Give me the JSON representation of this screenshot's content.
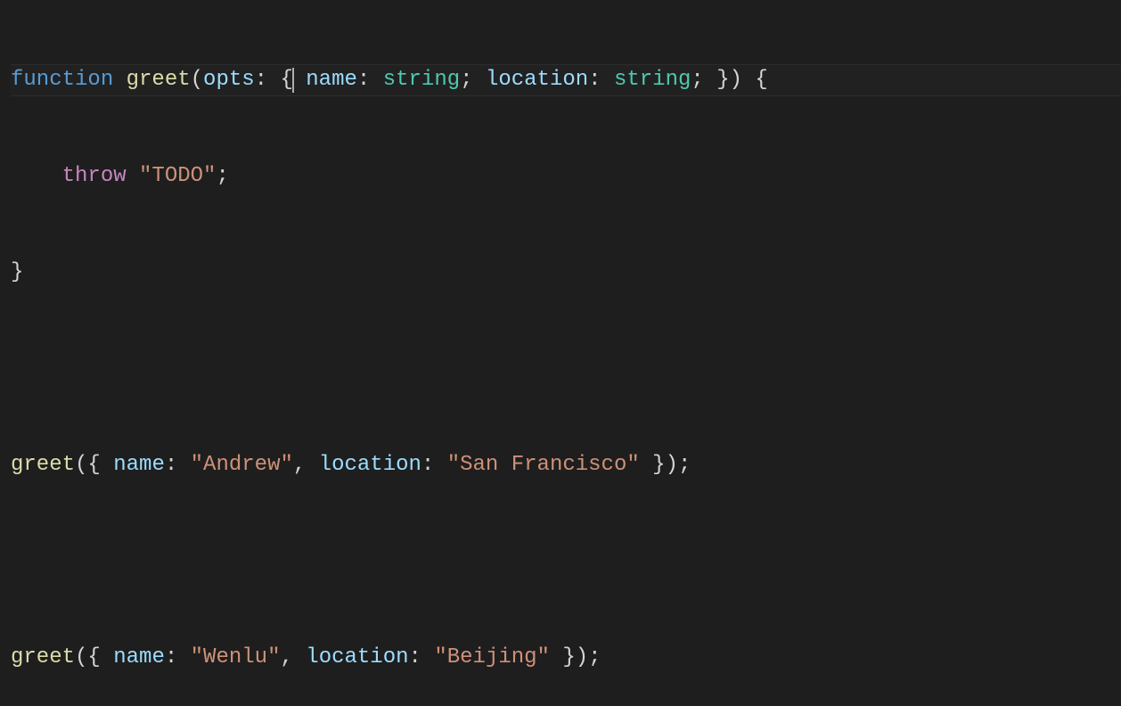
{
  "code": {
    "line1": {
      "function": "function",
      "funcName": "greet",
      "openParen": "(",
      "param": "opts",
      "colon1": ":",
      "openBrace1": "{",
      "prop1": "name",
      "colon2": ":",
      "type1": "string",
      "semi1": ";",
      "prop2": "location",
      "colon3": ":",
      "type2": "string",
      "semi2": ";",
      "closeBrace1": "}",
      "closeParen": ")",
      "openBrace2": "{"
    },
    "line2": {
      "indent": "    ",
      "throw": "throw",
      "string": "\"TODO\"",
      "semi": ";"
    },
    "line3": {
      "closeBrace": "}"
    },
    "line5": {
      "funcCall": "greet",
      "openParen": "(",
      "openBrace": "{",
      "prop1": "name",
      "colon1": ":",
      "val1": "\"Andrew\"",
      "comma": ",",
      "prop2": "location",
      "colon2": ":",
      "val2": "\"San Francisco\"",
      "closeBrace": "}",
      "closeParen": ")",
      "semi": ";"
    },
    "line7": {
      "funcCall": "greet",
      "openParen": "(",
      "openBrace": "{",
      "prop1": "name",
      "colon1": ":",
      "val1": "\"Wenlu\"",
      "comma": ",",
      "prop2": "location",
      "colon2": ":",
      "val2": "\"Beijing\"",
      "closeBrace": "}",
      "closeParen": ")",
      "semi": ";"
    }
  }
}
